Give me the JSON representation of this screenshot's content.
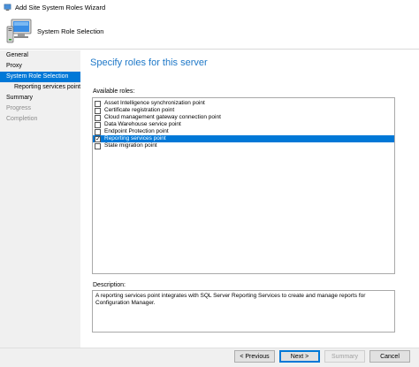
{
  "window": {
    "title": "Add Site System Roles Wizard"
  },
  "header": {
    "title": "System Role Selection"
  },
  "nav": {
    "items": [
      {
        "label": "General",
        "state": "normal",
        "level": 0
      },
      {
        "label": "Proxy",
        "state": "normal",
        "level": 0
      },
      {
        "label": "System Role Selection",
        "state": "active",
        "level": 0
      },
      {
        "label": "Reporting services point",
        "state": "normal",
        "level": 1
      },
      {
        "label": "Summary",
        "state": "normal",
        "level": 0
      },
      {
        "label": "Progress",
        "state": "disabled",
        "level": 0
      },
      {
        "label": "Completion",
        "state": "disabled",
        "level": 0
      }
    ]
  },
  "main": {
    "heading": "Specify roles for this server",
    "available_roles_label": "Available roles:",
    "roles": [
      {
        "label": "Asset Intelligence synchronization point",
        "checked": false,
        "selected": false
      },
      {
        "label": "Certificate registration point",
        "checked": false,
        "selected": false
      },
      {
        "label": "Cloud management gateway connection point",
        "checked": false,
        "selected": false
      },
      {
        "label": "Data Warehouse service point",
        "checked": false,
        "selected": false
      },
      {
        "label": "Endpoint Protection point",
        "checked": false,
        "selected": false
      },
      {
        "label": "Reporting services point",
        "checked": true,
        "selected": true
      },
      {
        "label": "State migration point",
        "checked": false,
        "selected": false
      }
    ],
    "description_label": "Description:",
    "description_text": "A reporting services point integrates with SQL Server Reporting Services to create and manage reports for Configuration Manager."
  },
  "footer": {
    "previous_label": "< Previous",
    "next_label": "Next >",
    "summary_label": "Summary",
    "cancel_label": "Cancel"
  },
  "colors": {
    "accent": "#0078d7",
    "heading": "#1e78c8",
    "nav_bg": "#f0f0f0"
  },
  "icons": {
    "app": "wizard-app-icon",
    "header": "computer-icon"
  }
}
